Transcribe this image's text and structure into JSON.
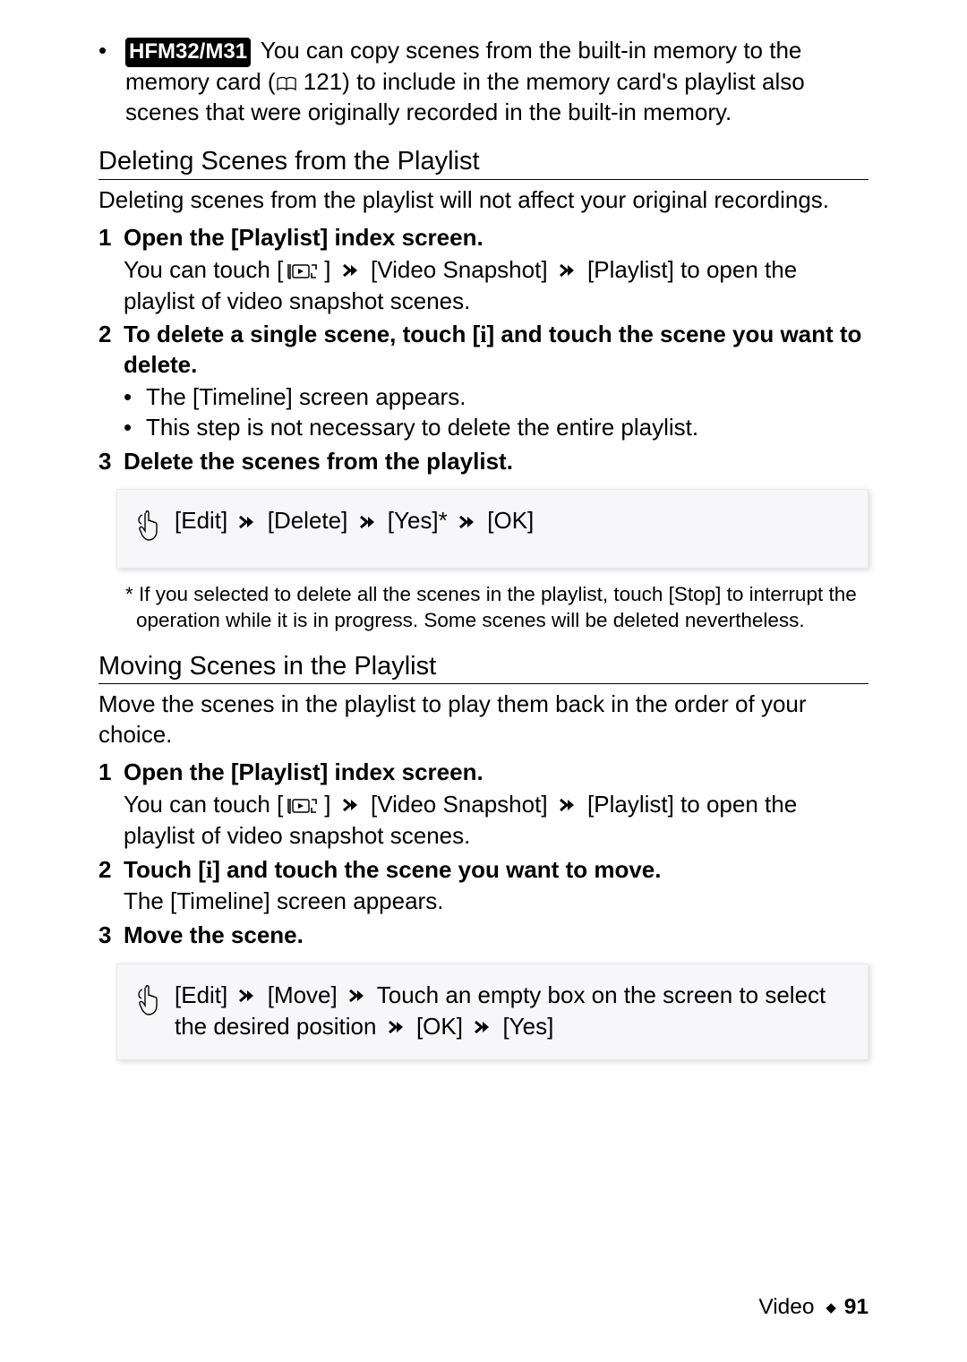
{
  "top_note": {
    "badge": "HFM32/M31",
    "text_part1": " You can copy scenes from the built-in memory to the memory card (",
    "book_icon": "open-book-icon",
    "page_ref": " 121) to include in the memory card's playlist also scenes that were originally recorded in the built-in memory."
  },
  "section_delete": {
    "title": "Deleting Scenes from the Playlist",
    "intro": "Deleting scenes from the playlist will not affect your original recordings.",
    "steps": [
      {
        "num": "1",
        "head": "Open the [Playlist] index screen.",
        "sub_line_pre": "You can touch [",
        "sub_line_post": "] ",
        "path1": "[Video Snapshot]",
        "path2": "[Playlist] to open the playlist of video snapshot scenes."
      },
      {
        "num": "2",
        "head_pre": "To delete a single scene, touch [",
        "head_post": "] and touch the scene you want to delete.",
        "bullets": [
          "The [Timeline] screen appears.",
          "This step is not necessary to delete the entire playlist."
        ]
      },
      {
        "num": "3",
        "head": "Delete the scenes from the playlist."
      }
    ],
    "touch_sequence": {
      "items": [
        "[Edit]",
        "[Delete]",
        "[Yes]*",
        "[OK]"
      ]
    },
    "footnote": "* If you selected to delete all the scenes in the playlist, touch [Stop] to interrupt the operation while it is in progress. Some scenes will be deleted nevertheless."
  },
  "section_move": {
    "title": "Moving Scenes in the Playlist",
    "intro": "Move the scenes in the playlist to play them back in the order of your choice.",
    "steps": [
      {
        "num": "1",
        "head": "Open the [Playlist] index screen.",
        "sub_line_pre": "You can touch [",
        "sub_line_post": "] ",
        "path1": "[Video Snapshot]",
        "path2": "[Playlist] to open the playlist of video snapshot scenes."
      },
      {
        "num": "2",
        "head_pre": "Touch [",
        "head_post": "] and touch the scene you want to move.",
        "sub_line": "The [Timeline] screen appears."
      },
      {
        "num": "3",
        "head": "Move the scene."
      }
    ],
    "touch_sequence": {
      "items": [
        "[Edit]",
        "[Move]",
        "Touch an empty box on the screen to select the desired position",
        "[OK]",
        "[Yes]"
      ]
    }
  },
  "footer": {
    "section": "Video",
    "diamond": "◆",
    "page": "91"
  }
}
